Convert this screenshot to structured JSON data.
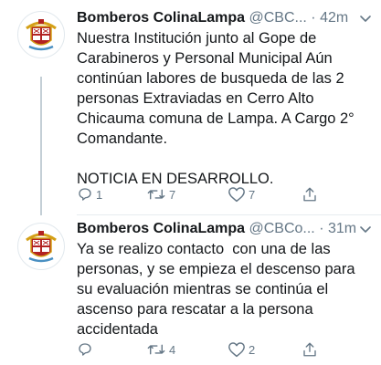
{
  "colors": {
    "text": "#14171a",
    "secondary": "#657786",
    "divider": "#e6ecf0",
    "thread": "#c4cfd6"
  },
  "tweets": [
    {
      "name": "Bomberos ColinaLampa",
      "handle": "@CBC...",
      "separator": "·",
      "time": "42m",
      "text": "Nuestra Institución junto al Gope de\nCarabineros y Personal Municipal Aún\ncontinúan labores de busqueda de las 2\npersonas Extraviadas en Cerro Alto\nChicauma comuna de Lampa. A Cargo 2°\nComandante.\n\nNOTICIA EN DESARROLLO.",
      "replies": "1",
      "retweets": "7",
      "likes": "7"
    },
    {
      "name": "Bomberos ColinaLampa",
      "handle": "@CBCo...",
      "separator": "·",
      "time": "31m",
      "text": "Ya se realizo contacto  con una de las\npersonas, y se empieza el descenso para\nsu evaluación mientras se continúa el\nascenso para rescatar a la persona\naccidentada",
      "replies": "",
      "retweets": "4",
      "likes": "2"
    }
  ],
  "icons": {
    "avatar": "fire-department-crest-icon",
    "menu": "chevron-down-icon",
    "reply": "reply-icon",
    "retweet": "retweet-icon",
    "like": "heart-icon",
    "share": "share-icon"
  }
}
